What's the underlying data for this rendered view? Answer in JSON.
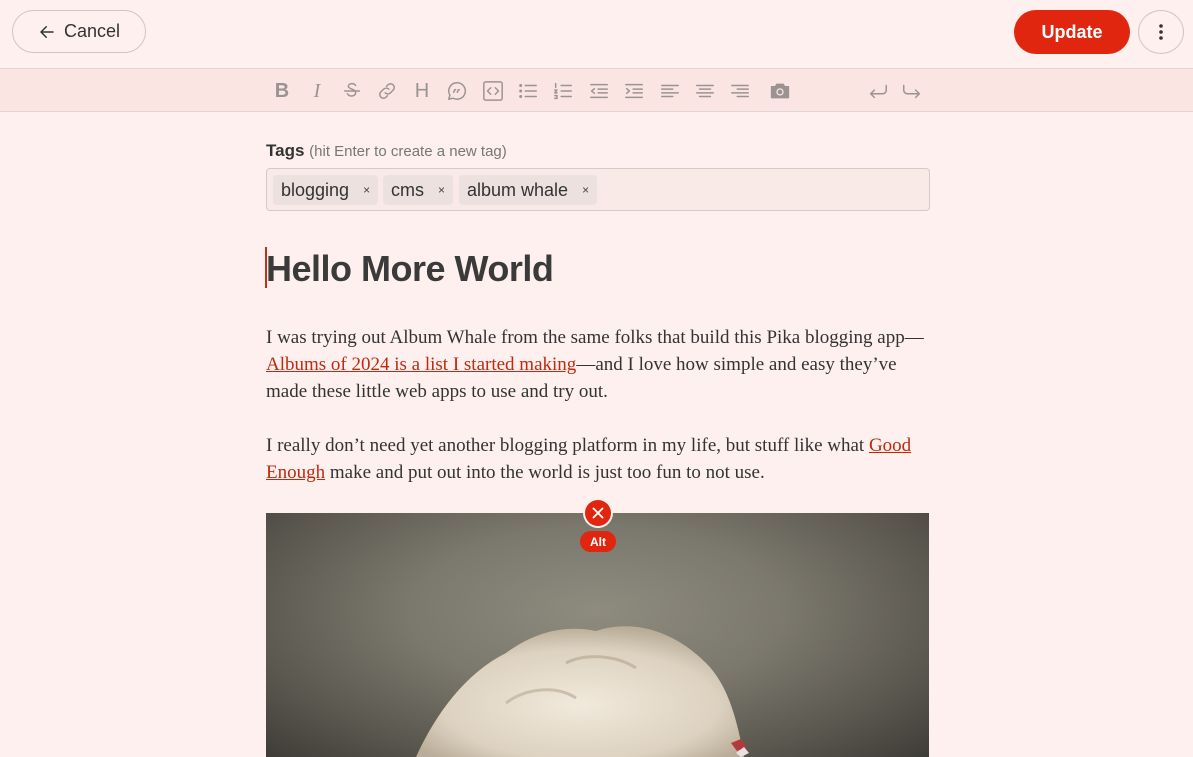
{
  "header": {
    "cancel_label": "Cancel",
    "update_label": "Update",
    "accent": "#e0260f"
  },
  "toolbar": {
    "tools": [
      "bold-icon",
      "italic-icon",
      "strikethrough-icon",
      "link-icon",
      "heading-icon",
      "quote-icon",
      "code-icon",
      "bullet-list-icon",
      "numbered-list-icon",
      "outdent-icon",
      "indent-icon",
      "align-left-icon",
      "align-center-icon",
      "align-right-icon",
      "camera-icon",
      "undo-icon",
      "redo-icon"
    ],
    "bold_glyph": "B",
    "italic_glyph": "I",
    "heading_glyph": "H"
  },
  "tags": {
    "label": "Tags",
    "hint": "(hit Enter to create a new tag)",
    "items": [
      "blogging",
      "cms",
      "album whale"
    ],
    "remove_glyph": "×"
  },
  "post": {
    "title": "Hello More World",
    "p1_a": "I was trying out Album Whale from the same folks that build this Pika blogging app—",
    "p1_link": "Albums of 2024 is a list I started making",
    "p1_b": "—and I love how simple and easy they’ve made these little web apps to use and try out.",
    "p2_a": "I really don’t need yet another blogging platform in my life, but stuff like what ",
    "p2_link": "Good Enough",
    "p2_b": " make and put out into the world is just too fun to not use."
  },
  "image": {
    "alt_label": "Alt"
  }
}
